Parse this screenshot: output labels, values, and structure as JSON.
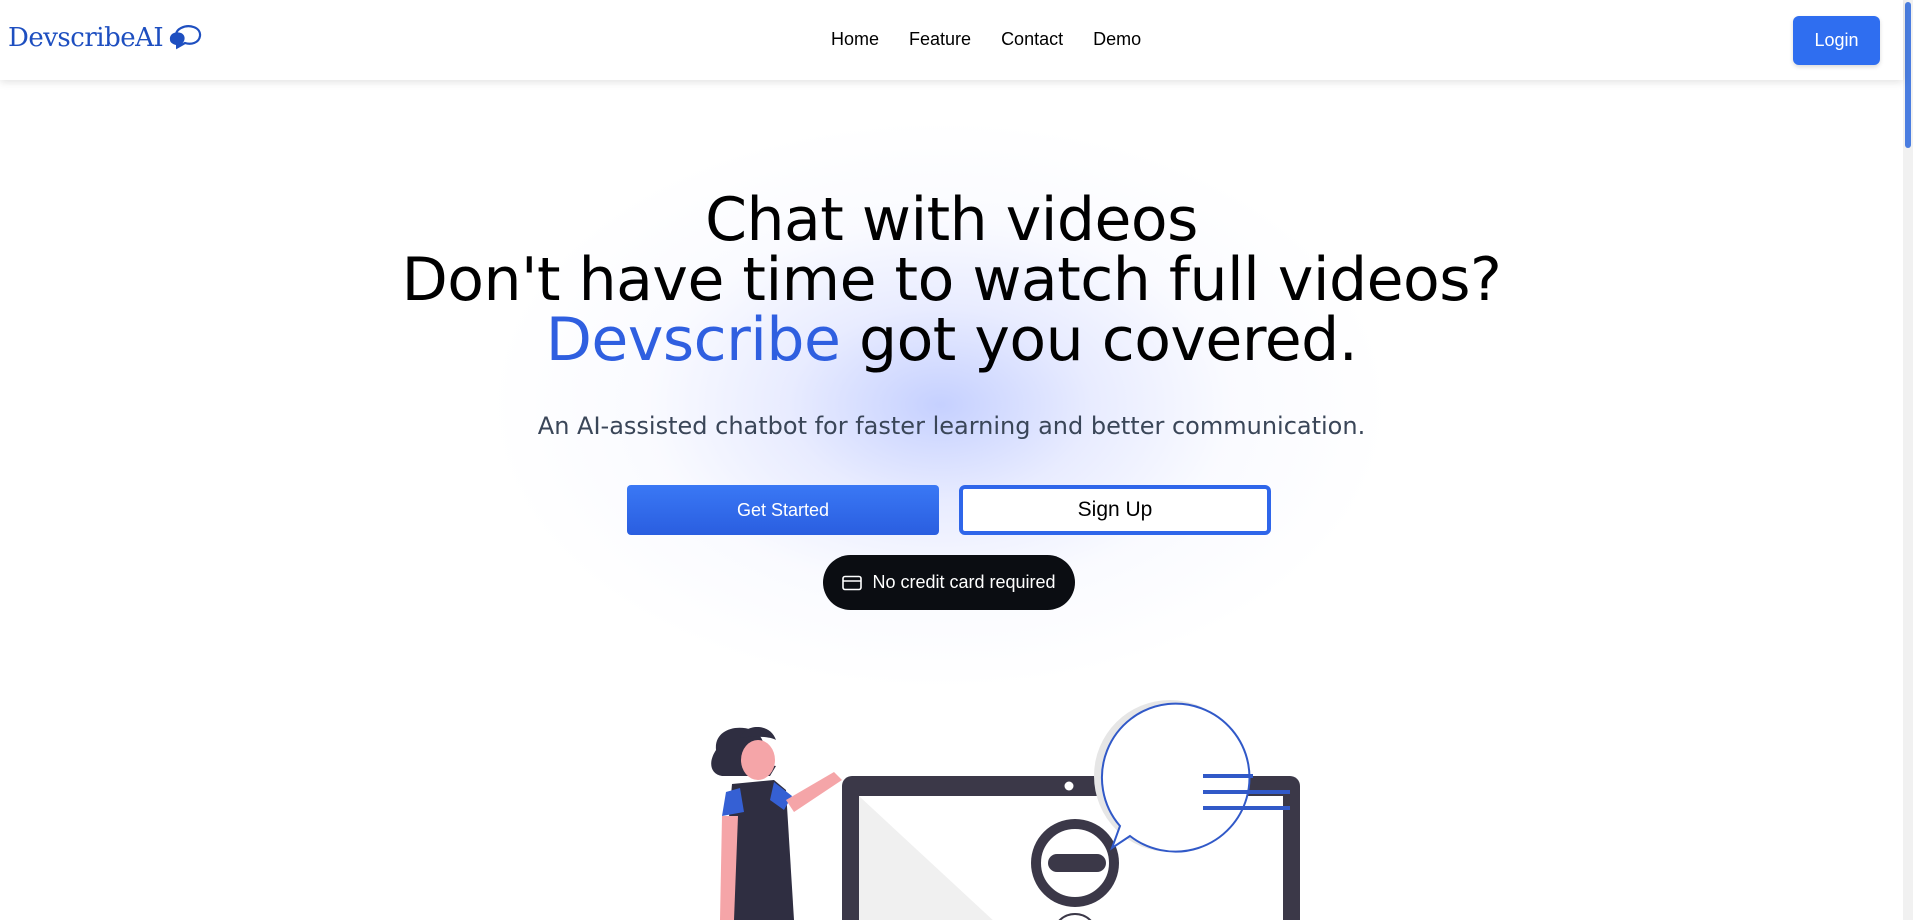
{
  "brand": {
    "name": "DevscribeAI",
    "logo_icon": "chat-bubbles-icon"
  },
  "nav": {
    "links": [
      "Home",
      "Feature",
      "Contact",
      "Demo"
    ],
    "login_label": "Login"
  },
  "hero": {
    "line1": "Chat with videos",
    "line2": "Don't have time to watch full videos?",
    "line3_accent": "Devscribe",
    "line3_rest": " got you covered.",
    "subtitle": "An AI-assisted chatbot for faster learning and better communication."
  },
  "cta": {
    "primary_label": "Get Started",
    "secondary_label": "Sign Up",
    "badge_label": "No credit card required",
    "badge_icon": "credit-card-icon"
  },
  "illustration": {
    "icon": "chatbot-illustration"
  },
  "colors": {
    "accent": "#2f5fe0",
    "button": "#2f6ef0",
    "badge_bg": "#0b0d12"
  }
}
